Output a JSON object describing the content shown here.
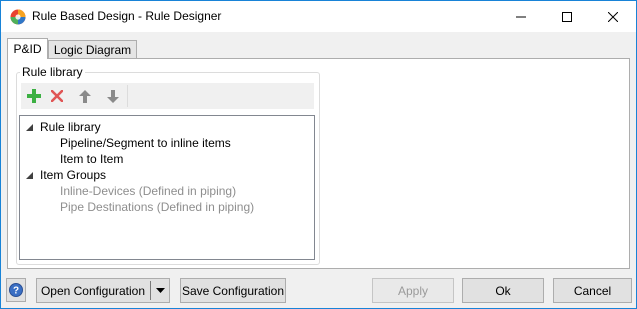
{
  "window": {
    "title": "Rule Based Design - Rule Designer"
  },
  "tabs": [
    {
      "label": "P&ID",
      "selected": true
    },
    {
      "label": "Logic Diagram",
      "selected": false
    }
  ],
  "rule_library": {
    "group_label": "Rule library",
    "toolbar": {
      "add_icon": "plus-icon",
      "delete_icon": "x-icon",
      "up_icon": "arrow-up-icon",
      "down_icon": "arrow-down-icon"
    },
    "tree": [
      {
        "label": "Rule library",
        "level": 0,
        "expanded": true,
        "enabled": true
      },
      {
        "label": "Pipeline/Segment to inline items",
        "level": 1,
        "enabled": true
      },
      {
        "label": "Item to Item",
        "level": 1,
        "enabled": true
      },
      {
        "label": "Item Groups",
        "level": 0,
        "expanded": true,
        "enabled": true
      },
      {
        "label": "Inline-Devices (Defined in piping)",
        "level": 1,
        "enabled": false
      },
      {
        "label": "Pipe Destinations (Defined in piping)",
        "level": 1,
        "enabled": false
      }
    ]
  },
  "footer": {
    "help_icon": "help-icon",
    "open_config_label": "Open Configuration",
    "save_config_label": "Save Configuration",
    "apply_label": "Apply",
    "ok_label": "Ok",
    "cancel_label": "Cancel"
  },
  "colors": {
    "accent_border": "#1883d7",
    "add_green": "#3cb043",
    "delete_red": "#e05555",
    "disabled_text": "#8e8e8e"
  }
}
